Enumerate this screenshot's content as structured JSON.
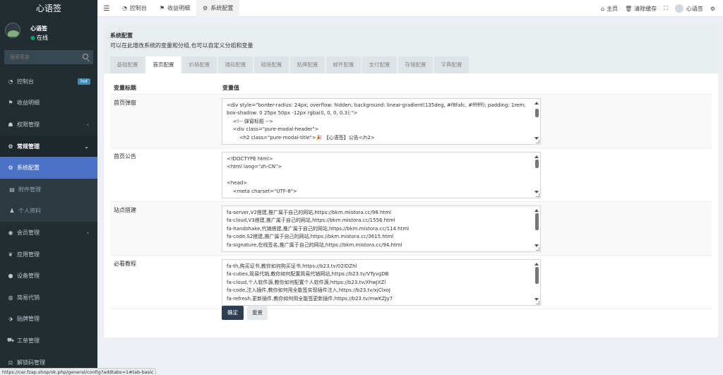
{
  "sidebar": {
    "logo": "心语签",
    "user": {
      "name": "心语签",
      "status": "在线"
    },
    "search": {
      "placeholder": "搜索菜单"
    },
    "items": [
      {
        "label": "控制台",
        "icon": "dashboard-icon",
        "badge": "hot"
      },
      {
        "label": "收益明细",
        "icon": "flag-icon"
      },
      {
        "label": "权限管理",
        "icon": "group-icon"
      },
      {
        "label": "常规管理",
        "icon": "cogs-icon"
      },
      {
        "label": "系统配置",
        "icon": "gear-icon"
      },
      {
        "label": "附件管理",
        "icon": "file-icon"
      },
      {
        "label": "个人资料",
        "icon": "user-icon"
      },
      {
        "label": "会员管理",
        "icon": "user-circle-icon"
      },
      {
        "label": "应用管理",
        "icon": "leaf-icon"
      },
      {
        "label": "设备管理",
        "icon": "device-icon"
      },
      {
        "label": "简易代销",
        "icon": "coin-icon"
      },
      {
        "label": "贴牌管理",
        "icon": "tag-icon"
      },
      {
        "label": "工单管理",
        "icon": "car-icon"
      },
      {
        "label": "解锁码管理",
        "icon": "balance-icon"
      }
    ]
  },
  "status_url": "https://cer.fzap.shop/ok.php/general/config?addtabs=1#tab-basic",
  "navbar": {
    "tabs": [
      {
        "label": "控制台",
        "icon": "dashboard-icon"
      },
      {
        "label": "收益明细",
        "icon": "flag-icon"
      },
      {
        "label": "系统配置",
        "icon": "gear-icon"
      }
    ],
    "right": {
      "home": "主页",
      "clear_cache": "清除缓存",
      "user": "心语签"
    }
  },
  "panel": {
    "title": "系统配置",
    "description": "可以在此增改系统的变量和分组,也可以自定义分组和变量",
    "tabs": [
      "基础配置",
      "首页配置",
      "价格配置",
      "通知配置",
      "链接配置",
      "贴牌配置",
      "邮件配置",
      "支付配置",
      "存储配置",
      "字典配置"
    ],
    "active_tab": "首页配置"
  },
  "table": {
    "headers": {
      "title": "变量标题",
      "value": "变量值"
    },
    "rows": [
      {
        "title": "首页弹窗",
        "value": "<div style=\"border-radius: 24px; overflow: hidden; background: linear-gradient(135deg, #f8fafc, #ffffff); padding: 1rem; box-shadow: 0 25px 50px -12px rgba(0, 0, 0, 0.3);\">\n    <!-- 弹窗标题 -->\n    <div class=\"pure-modal-header\">\n        <h2 class=\"pure-modal-title\">🎉 【心语签】公告</h2>"
      },
      {
        "title": "首页公告",
        "value": "<!DOCTYPE html>\n<html lang=\"zh-CN\">\n\n<head>\n    <meta charset=\"UTF-8\">"
      },
      {
        "title": "站点搭建",
        "value": "fa-server,V2搭建,推广属于自己的网站,https://bkm.mistora.cc/98.html\nfa-cloud,V3搭建,推广属于自己的网站,https://bkm.mistora.cc/1556.html\nfa-handshake,代销搭建,推广属于自己的网站,https://bkm.mistora.cc/114.html\nfa-code,S2搭建,推广属于自己的网站,https://bkm.mistora.cc/3615.html\nfa-signature,在线签名,推广属于自己的网站,https://bkm.mistora.cc/94.html"
      },
      {
        "title": "必看教程",
        "value": "fa-th,购买证书,教你如何购买证书,https://b23.tv/02lDZhl\nfa-cubes,简易代销,教你如何配置简易代销网站,https://b23.tv/VTyvgDB\nfa-cloud,个人软件源,教你如何配置个人软件源,https://b23.tv/XhwJXZl\nfa-code,注入插件,教你如何用全能签实现插件注入,https://b23.tv/xjClxoJ\nfa-refresh,更新插件,教你如何用全能签更新插件,https://b23.tv/mwKZJy7"
      }
    ]
  },
  "buttons": {
    "confirm": "确定",
    "reset": "重置"
  },
  "colors": {
    "sidebar_bg": "#222d32",
    "active_item": "#4b72c4",
    "confirm_button": "#2c3e50"
  }
}
